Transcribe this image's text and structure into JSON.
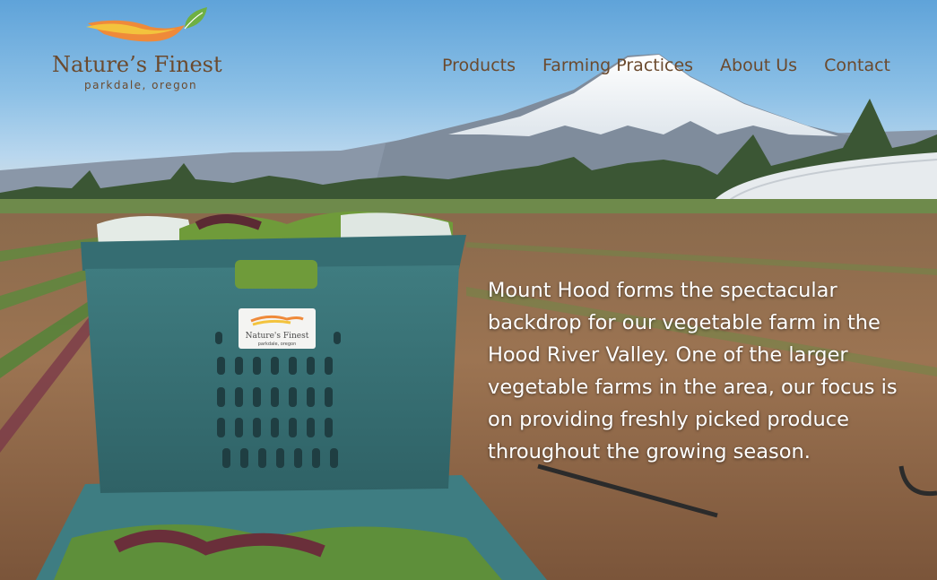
{
  "brand": {
    "name": "Nature’s Finest",
    "location": "parkdale, oregon",
    "colors": {
      "text": "#6b4a2e",
      "leaf": "#6fb043",
      "swoosh_orange": "#ef8a3a",
      "swoosh_yellow": "#f3c33d"
    }
  },
  "nav": {
    "items": [
      {
        "label": "Products"
      },
      {
        "label": "Farming Practices"
      },
      {
        "label": "About Us"
      },
      {
        "label": "Contact"
      }
    ]
  },
  "hero": {
    "tagline": "Mount Hood forms the spectacular backdrop for our vegetable farm in the Hood River Valley. One of the larger vegetable farms in the area, our focus is on providing freshly picked produce throughout the growing season.",
    "crate_label_name": "Nature's Finest",
    "crate_label_sub": "parkdale, oregon"
  }
}
